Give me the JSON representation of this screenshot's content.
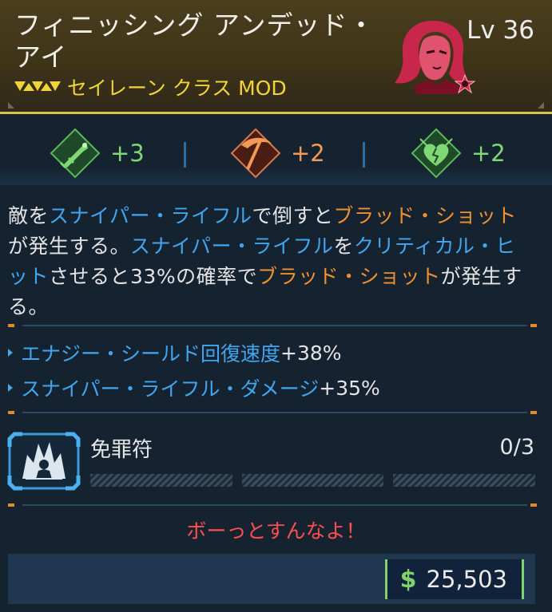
{
  "item": {
    "name": "フィニッシング アンデッド・アイ",
    "level": "Lv 36",
    "class_type": "セイレーン クラス MOD",
    "rarity_color": "#f0d43a",
    "portrait_icon": "siren-portrait-icon"
  },
  "skills": [
    {
      "icon": "sniper-rifle-rocket-icon",
      "bonus": "+3",
      "color": "#7fd873"
    },
    {
      "icon": "scythe-icon",
      "bonus": "+2",
      "color": "#f29a55"
    },
    {
      "icon": "cracked-heart-icon",
      "bonus": "+2",
      "color": "#7fd873"
    }
  ],
  "description": {
    "p1": "敵を",
    "k1": "スナイパー・ライフル",
    "p2": "で倒すと",
    "k2": "ブラッド・ショット",
    "p3": "が発生する。",
    "k3": "スナイパー・ライフル",
    "p4": "を",
    "k4": "クリティカル・ヒット",
    "p5": "させると33%の確率で",
    "k5": "ブラッド・ショット",
    "p6": "が発生する。"
  },
  "stats": [
    {
      "name": "エナジー・シールド回復速度",
      "value": "+38%"
    },
    {
      "name": "スナイパー・ライフル・ダメージ",
      "value": "+35%"
    }
  ],
  "perk": {
    "icon": "explosion-figure-icon",
    "name": "免罪符",
    "count": "0/3"
  },
  "flavor_text": "ボーっとすんなよ！",
  "price": {
    "currency_icon": "dollar-icon",
    "symbol": "$",
    "value": "25,503"
  },
  "colors": {
    "keyword_blue": "#41a6f0",
    "keyword_orange": "#f2902e",
    "flavor_red": "#ff4f4f",
    "money_green": "#7fd36a"
  }
}
